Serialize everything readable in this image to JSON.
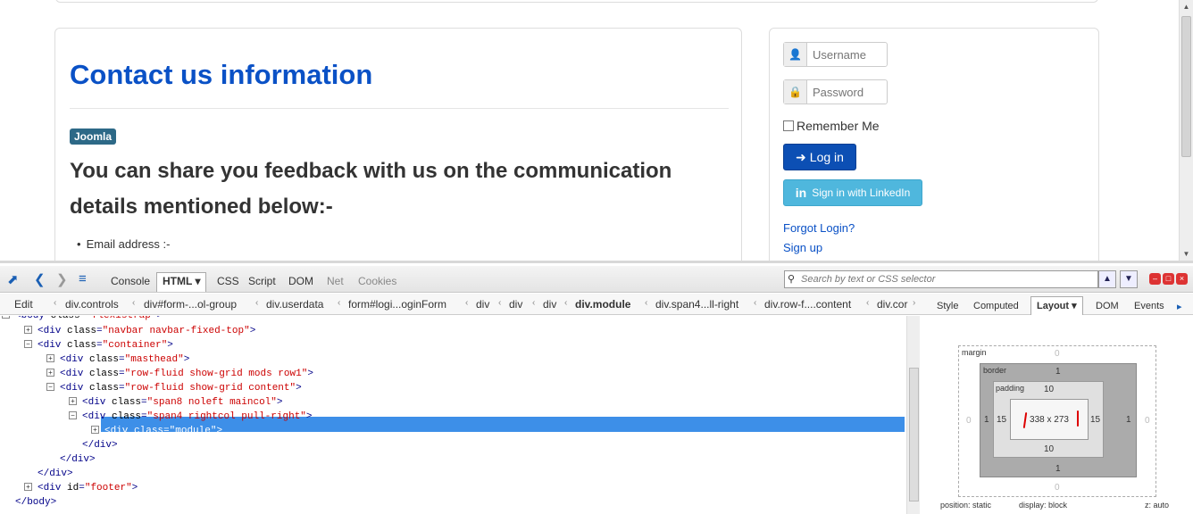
{
  "main": {
    "title": "Contact us information",
    "tag": "Joomla",
    "headline": "You can share you feedback with us on the communication details mentioned below:-",
    "bullet": "Email address :-"
  },
  "login": {
    "username_placeholder": "Username",
    "password_placeholder": "Password",
    "remember_label": "Remember Me",
    "login_button": "Log in",
    "linkedin_button": "Sign in with LinkedIn",
    "forgot_link": "Forgot Login?",
    "signup_link": "Sign up"
  },
  "devtools": {
    "tabs": [
      "Console",
      "HTML",
      "CSS",
      "Script",
      "DOM",
      "Net",
      "Cookies"
    ],
    "search_placeholder": "Search by text or CSS selector",
    "edit_label": "Edit",
    "breadcrumbs": [
      "div.controls",
      "div#form-...ol-group",
      "div.userdata",
      "form#logi...oginForm",
      "div",
      "div",
      "div.module",
      "div.span4...ll-right",
      "div.row-f....content",
      "div.cor"
    ],
    "side_tabs": [
      "Style",
      "Computed",
      "Layout",
      "DOM",
      "Events"
    ],
    "dom_lines": [
      {
        "tag": "body",
        "attr": "class",
        "value": "flexistrap"
      },
      {
        "tag": "div",
        "attr": "class",
        "value": "navbar navbar-fixed-top"
      },
      {
        "tag": "div",
        "attr": "class",
        "value": "container"
      },
      {
        "tag": "div",
        "attr": "class",
        "value": "masthead"
      },
      {
        "tag": "div",
        "attr": "class",
        "value": "row-fluid show-grid mods row1"
      },
      {
        "tag": "div",
        "attr": "class",
        "value": "row-fluid show-grid content"
      },
      {
        "tag": "div",
        "attr": "class",
        "value": "span8 noleft maincol"
      },
      {
        "tag": "div",
        "attr": "class",
        "value": "span4 rightcol pull-right"
      },
      {
        "tag": "div",
        "attr": "class",
        "value": "module"
      },
      {
        "close": "</div>"
      },
      {
        "close": "</div>"
      },
      {
        "close": "</div>"
      },
      {
        "tag": "div",
        "attr": "id",
        "value": "footer"
      },
      {
        "close": "</body>"
      }
    ],
    "layout": {
      "margin_label": "margin",
      "border_label": "border",
      "padding_label": "padding",
      "margin": {
        "top": "0",
        "right": "0",
        "bottom": "0",
        "left": "0"
      },
      "border": {
        "top": "1",
        "right": "1",
        "bottom": "1",
        "left": "1"
      },
      "padding": {
        "top": "10",
        "right": "15",
        "bottom": "10",
        "left": "15"
      },
      "content": "338 x 273",
      "position": "position: static",
      "display": "display: block",
      "z": "z: auto"
    }
  },
  "colors": {
    "title": "#0a51c6",
    "login_button": "#0c4fb4",
    "linkedin_button": "#4fb7dd",
    "selection": "#3d8fe8"
  }
}
